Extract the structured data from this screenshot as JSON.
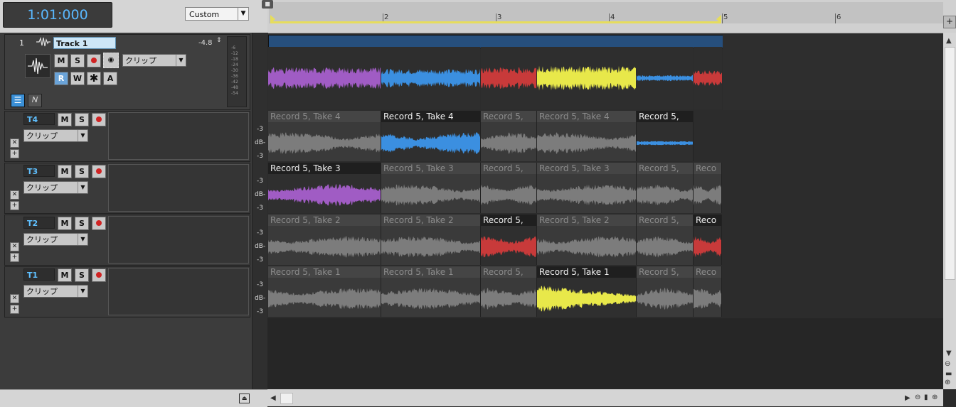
{
  "transport": {
    "time": "1:01:000",
    "preset": "Custom"
  },
  "ruler": {
    "marks": [
      "2",
      "3",
      "4",
      "5",
      "6"
    ]
  },
  "parent_track": {
    "number": "1",
    "name": "Track 1",
    "volume": "-4.8",
    "buttons": {
      "mute": "M",
      "solo": "S",
      "read": "R",
      "write": "W",
      "fx": "A"
    },
    "dropdown": "クリップ",
    "meter_labels": [
      "-6",
      "-12",
      "-18",
      "-24",
      "-30",
      "-36",
      "-42",
      "-48",
      "-54"
    ]
  },
  "lanes": [
    {
      "name": "T4",
      "dropdown": "クリップ",
      "mute": "M",
      "solo": "S",
      "db_top": "-3",
      "db_mid": "dB-",
      "db_bot": "-3"
    },
    {
      "name": "T3",
      "dropdown": "クリップ",
      "mute": "M",
      "solo": "S",
      "db_top": "-3",
      "db_mid": "dB-",
      "db_bot": "-3"
    },
    {
      "name": "T2",
      "dropdown": "クリップ",
      "mute": "M",
      "solo": "S",
      "db_top": "-3",
      "db_mid": "dB-",
      "db_bot": "-3"
    },
    {
      "name": "T1",
      "dropdown": "クリップ",
      "mute": "M",
      "solo": "S",
      "db_top": "-3",
      "db_mid": "dB-",
      "db_bot": "-3"
    }
  ],
  "lane_clips": [
    [
      "Record 5, Take 4",
      "Record 5, Take 4",
      "Record 5,",
      "Record 5, Take 4",
      "Record 5,"
    ],
    [
      "Record 5, Take 3",
      "Record 5, Take 3",
      "Record 5,",
      "Record 5, Take 3",
      "Record 5,",
      "Reco"
    ],
    [
      "Record 5, Take 2",
      "Record 5, Take 2",
      "Record 5,",
      "Record 5, Take 2",
      "Record 5,",
      "Reco"
    ],
    [
      "Record 5, Take 1",
      "Record 5, Take 1",
      "Record 5,",
      "Record 5, Take 1",
      "Record 5,",
      "Reco"
    ]
  ],
  "colors": {
    "purple": "#a05cc4",
    "blue": "#3b8fe0",
    "red": "#c83a3a",
    "yellow": "#e8e84a",
    "gray": "#7c7c7c",
    "accent": "#5ab8ff"
  }
}
